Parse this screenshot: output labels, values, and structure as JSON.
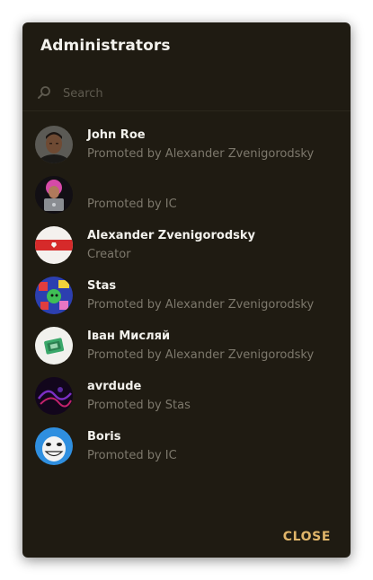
{
  "dialog": {
    "title": "Administrators",
    "close_label": "CLOSE",
    "accent_color": "#e0b56a",
    "background_color": "#1f1b12"
  },
  "search": {
    "placeholder": "Search",
    "value": "",
    "icon": "search-icon"
  },
  "admins": [
    {
      "name": "John Roe",
      "status": "Promoted by Alexander Zvenigorodsky",
      "avatar": "avatar-john-roe"
    },
    {
      "name": "",
      "status": "Promoted by IC",
      "avatar": "avatar-unnamed"
    },
    {
      "name": "Alexander Zvenigorodsky",
      "status": "Creator",
      "avatar": "avatar-flag"
    },
    {
      "name": "Stas",
      "status": "Promoted by Alexander Zvenigorodsky",
      "avatar": "avatar-stas"
    },
    {
      "name": "Іван Мисляй",
      "status": "Promoted by Alexander Zvenigorodsky",
      "avatar": "avatar-ivan"
    },
    {
      "name": "avrdude",
      "status": "Promoted by Stas",
      "avatar": "avatar-avrdude"
    },
    {
      "name": "Boris",
      "status": "Promoted by IC",
      "avatar": "avatar-boris"
    }
  ]
}
